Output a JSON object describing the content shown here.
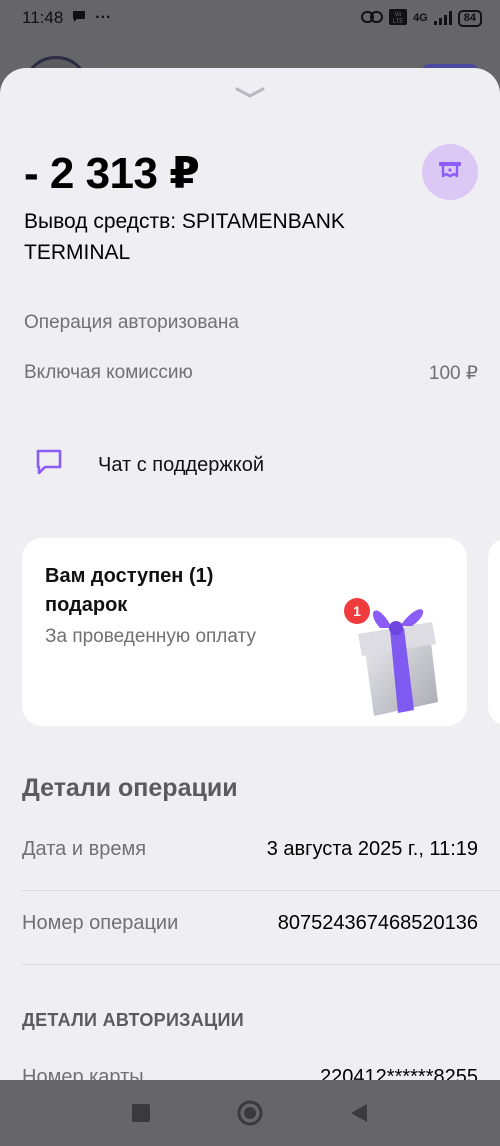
{
  "status_bar": {
    "time": "11:48",
    "overflow": "···",
    "network": "4G",
    "battery": "84",
    "icons": [
      "chat-bubble-icon",
      "link-icon",
      "volte-icon",
      "signal-icon",
      "battery-icon"
    ]
  },
  "sheet": {
    "amount": "- 2 313 ₽",
    "title": "Вывод средств: SPITAMENBANK TERMINAL",
    "receipt_icon": "receipt-icon",
    "status": "Операция авторизована",
    "fee_label": "Включая комиссию",
    "fee_value": "100 ₽",
    "chat_label": "Чат с поддержкой",
    "gift": {
      "title": "Вам доступен (1) подарок",
      "subtitle": "За проведенную оплату",
      "badge": "1"
    },
    "details_title": "Детали операции",
    "details": [
      {
        "label": "Дата и время",
        "value": "3 августа 2025 г., 11:19"
      },
      {
        "label": "Номер операции",
        "value": "807524367468520136"
      }
    ],
    "auth_title": "ДЕТАЛИ АВТОРИЗАЦИИ",
    "card_row": {
      "label": "Номер карты",
      "value": "220412******8255"
    }
  },
  "colors": {
    "accent": "#8b5cf6",
    "sheet_bg": "#efeef3",
    "overlay": "#666568",
    "muted_text": "#707075"
  }
}
